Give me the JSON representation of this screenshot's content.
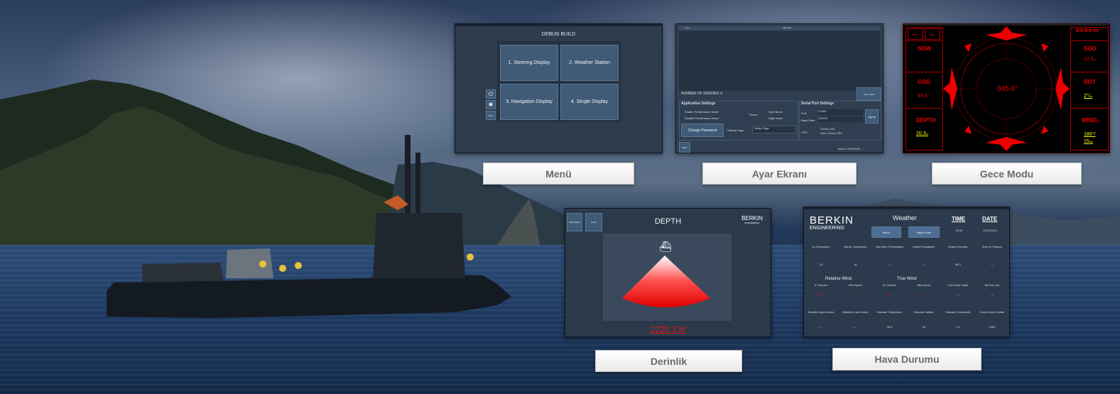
{
  "labels": {
    "menu": "Menü",
    "settings": "Ayar Ekranı",
    "night": "Gece Modu",
    "depth": "Derinlik",
    "weather": "Hava Durumu"
  },
  "menu_screen": {
    "title": "DEBUG BUILD",
    "buttons": [
      "1. Steering Display",
      "2. Weather Station",
      "3. Navigation Display",
      "4. Single Display"
    ],
    "side_icons": [
      "power-icon",
      "gear-icon"
    ],
    "side_text": "Input"
  },
  "settings_screen": {
    "header_left": "Type",
    "header_center": "Message",
    "errors": "NUMBER OF ERRORS: 0",
    "clear_table": "Clear Table",
    "app_settings": "Application Settings",
    "enable_perf": "Enable Performance Mode",
    "disable_perf": "Disable Performance Mode",
    "theme": "Theme:",
    "light_mode": "Light Mode",
    "night_mode": "Night Mode",
    "change_password": "Change Password",
    "startup_page": "Startup Page:",
    "setup_page": "Setup Page",
    "serial_settings": "Serial Port Settings",
    "port_label": "Port:",
    "port_value": "COM2",
    "baud_label": "Baud Rate:",
    "baud_value": "115200",
    "apply": "Apply",
    "crc_label": "CRC:",
    "check_crc": "Check CRC",
    "dont_check_crc": "Don't Check CRC",
    "build_version": "BUILD VERSION: ...",
    "back": "Back"
  },
  "night_screen": {
    "buttons": [
      "Back",
      "Day"
    ],
    "sow": {
      "label": "SOW",
      "value": ""
    },
    "cog": {
      "label": "COG",
      "value": "45.6°"
    },
    "depth": {
      "label": "DEPTH",
      "value": "20.3",
      "unit": "m"
    },
    "sog": {
      "label": "SOG",
      "value": "12.5",
      "unit": "kn"
    },
    "rot": {
      "label": "ROT",
      "value": "2°/",
      "unit": "m"
    },
    "wind": {
      "label": "WIND",
      "unit_sub": "kts",
      "value1": "180°/",
      "value2": "15",
      "unit2": "kts"
    },
    "heading": "045.6°",
    "logo": "BERKIN"
  },
  "depth_screen": {
    "buttons": [
      "Night Mode",
      "Setup"
    ],
    "title": "DEPTH",
    "value": "2220.3 M",
    "logo_top": "BERKIN",
    "logo_bottom": "ENGINEERING"
  },
  "weather_screen": {
    "logo_top": "BERKIN",
    "logo_bottom": "ENGINEERING",
    "title": "Weather",
    "menu": "Menu",
    "night_mode": "Night Mode",
    "time_label": "TIME",
    "time_value": "10:30",
    "date_label": "DATE",
    "date_value": "22/11/2024",
    "row1": [
      {
        "h": "Air Temperature",
        "v": "15"
      },
      {
        "h": "Wet Air Temperature",
        "v": "16"
      },
      {
        "h": "Total Rate of Precipitation",
        "v": "—"
      },
      {
        "h": "Instant Precipitation",
        "v": "—"
      },
      {
        "h": "Relative Humidity",
        "v": "56.3"
      },
      {
        "h": "Open Air Pressure",
        "v": "—"
      }
    ],
    "relative_wind": "Relative Wind",
    "true_wind": "True Wind",
    "row2": [
      {
        "h": "W. Direction",
        "v": "320"
      },
      {
        "h": "Wind Speed",
        "v": "11"
      },
      {
        "h": "W. Direction",
        "v": "320"
      },
      {
        "h": "Wind Speed",
        "v": "11"
      },
      {
        "h": "Cloud Base Height",
        "v": "—"
      },
      {
        "h": "Net Rad. Info",
        "v": "—"
      }
    ],
    "row3": [
      {
        "h": "Radiation Upper Bound",
        "v": "—"
      },
      {
        "h": "Radiation Lower Bound",
        "v": "—"
      },
      {
        "h": "Seawater Temperature",
        "v": "26.5"
      },
      {
        "h": "Seawater Salinity",
        "v": "35"
      },
      {
        "h": "Seawater Conductivity",
        "v": "2.5"
      },
      {
        "h": "Sound Speed in Water",
        "v": "1560"
      }
    ]
  }
}
